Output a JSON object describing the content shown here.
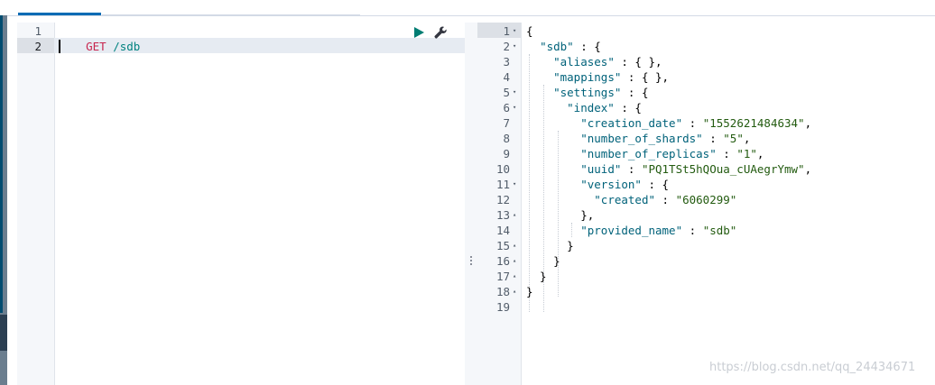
{
  "colors": {
    "accent": "#006bb4",
    "method": "#c7254e",
    "url": "#00827f",
    "key": "#00627a",
    "string": "#235b10"
  },
  "request": {
    "method": "GET",
    "url": "/sdb",
    "line_numbers": [
      "1",
      "2"
    ]
  },
  "toolbar": {
    "run_icon": "play-icon",
    "settings_icon": "wrench-icon"
  },
  "response": {
    "line_numbers": [
      "1",
      "2",
      "3",
      "4",
      "5",
      "6",
      "7",
      "8",
      "9",
      "10",
      "11",
      "12",
      "13",
      "14",
      "15",
      "16",
      "17",
      "18",
      "19"
    ],
    "fold_markers": [
      "▾",
      "▾",
      "",
      "",
      "▾",
      "▾",
      "",
      "",
      "",
      "",
      "▾",
      "",
      "▴",
      "",
      "▴",
      "▴",
      "▴",
      "▴",
      ""
    ],
    "lines": [
      "{",
      "  \"sdb\" : {",
      "    \"aliases\" : { },",
      "    \"mappings\" : { },",
      "    \"settings\" : {",
      "      \"index\" : {",
      "        \"creation_date\" : \"1552621484634\",",
      "        \"number_of_shards\" : \"5\",",
      "        \"number_of_replicas\" : \"1\",",
      "        \"uuid\" : \"PQ1TSt5hQOua_cUAegrYmw\",",
      "        \"version\" : {",
      "          \"created\" : \"6060299\"",
      "        },",
      "        \"provided_name\" : \"sdb\"",
      "      }",
      "    }",
      "  }",
      "}",
      ""
    ]
  },
  "watermark": "https://blog.csdn.net/qq_24434671"
}
